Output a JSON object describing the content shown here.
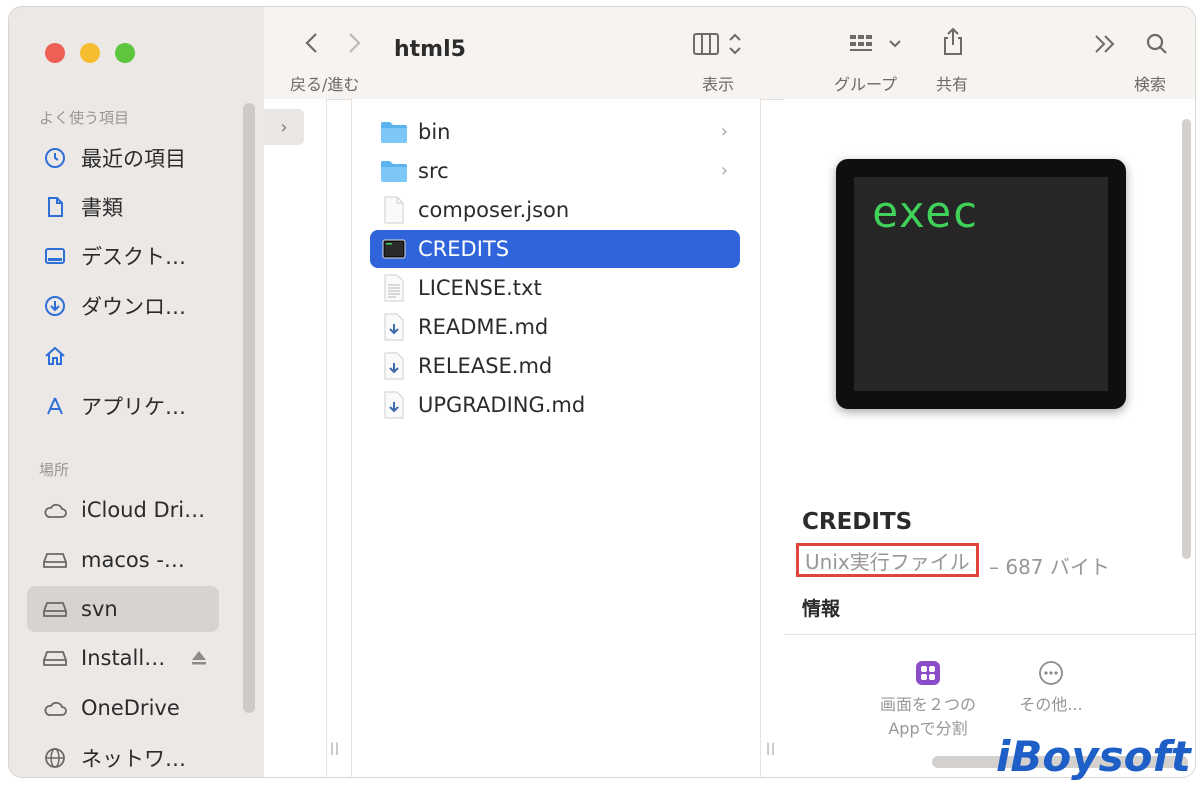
{
  "window": {
    "title": "html5"
  },
  "toolbar": {
    "back_forward_label": "戻る/進む",
    "view_label": "表示",
    "group_label": "グループ",
    "share_label": "共有",
    "search_label": "検索"
  },
  "sidebar": {
    "favorites_header": "よく使う項目",
    "favorites": [
      {
        "label": "最近の項目",
        "icon": "clock-icon"
      },
      {
        "label": "書類",
        "icon": "document-icon"
      },
      {
        "label": "デスクト…",
        "icon": "desktop-icon"
      },
      {
        "label": "ダウンロ…",
        "icon": "download-icon"
      },
      {
        "label": "",
        "icon": "home-icon"
      },
      {
        "label": "アプリケ…",
        "icon": "applications-icon"
      }
    ],
    "locations_header": "場所",
    "locations": [
      {
        "label": "iCloud Dri…",
        "icon": "cloud-icon"
      },
      {
        "label": "macos -…",
        "icon": "drive-icon"
      },
      {
        "label": "svn",
        "icon": "drive-icon",
        "selected": true
      },
      {
        "label": "Install…",
        "icon": "drive-icon",
        "eject": true
      },
      {
        "label": "OneDrive",
        "icon": "cloud-icon"
      },
      {
        "label": "ネットワ…",
        "icon": "network-icon"
      }
    ]
  },
  "files": [
    {
      "name": "bin",
      "type": "folder",
      "has_children": true
    },
    {
      "name": "src",
      "type": "folder",
      "has_children": true
    },
    {
      "name": "composer.json",
      "type": "file"
    },
    {
      "name": "CREDITS",
      "type": "exec",
      "selected": true
    },
    {
      "name": "LICENSE.txt",
      "type": "text"
    },
    {
      "name": "README.md",
      "type": "markdown"
    },
    {
      "name": "RELEASE.md",
      "type": "markdown"
    },
    {
      "name": "UPGRADING.md",
      "type": "markdown"
    }
  ],
  "preview": {
    "thumbnail_text": "exec",
    "name": "CREDITS",
    "kind": "Unix実行ファイル",
    "size": "– 687 バイト",
    "info_label": "情報",
    "actions": [
      {
        "line1": "画面を２つの",
        "line2": "Appで分割",
        "icon": "split-view-icon"
      },
      {
        "line1": "その他...",
        "line2": "",
        "icon": "more-icon"
      }
    ]
  },
  "watermark": "iBoysoft",
  "colors": {
    "selection": "#2f64db",
    "highlight_box": "#e0463d",
    "exec_green": "#3fd15a"
  }
}
